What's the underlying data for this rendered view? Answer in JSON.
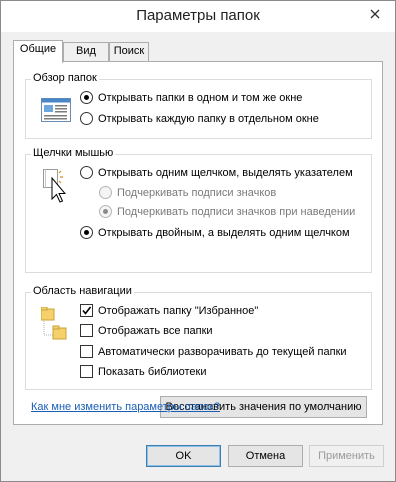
{
  "window": {
    "title": "Параметры папок",
    "close_label": "✕"
  },
  "tabs": [
    {
      "label": "Общие",
      "active": true
    },
    {
      "label": "Вид",
      "active": false
    },
    {
      "label": "Поиск",
      "active": false
    }
  ],
  "browse_folders": {
    "label": "Обзор папок",
    "options": [
      {
        "label": "Открывать папки в одном и том же окне",
        "checked": true
      },
      {
        "label": "Открывать каждую папку в отдельном окне",
        "checked": false
      }
    ]
  },
  "mouse_clicks": {
    "label": "Щелчки мышью",
    "options": [
      {
        "label": "Открывать одним щелчком, выделять указателем",
        "checked": false
      },
      {
        "label": "Подчеркивать подписи значков",
        "checked": false,
        "disabled": true
      },
      {
        "label": "Подчеркивать подписи значков при наведении",
        "checked": true,
        "disabled": true
      },
      {
        "label": "Открывать двойным, а выделять одним щелчком",
        "checked": true
      }
    ]
  },
  "navigation": {
    "label": "Область навигации",
    "options": [
      {
        "label": "Отображать папку \"Избранное\"",
        "checked": true
      },
      {
        "label": "Отображать все папки",
        "checked": false
      },
      {
        "label": "Автоматически разворачивать до текущей папки",
        "checked": false
      },
      {
        "label": "Показать библиотеки",
        "checked": false
      }
    ]
  },
  "restore_button": "Восстановить значения по умолчанию",
  "help_link": "Как мне изменить параметры папок?",
  "footer": {
    "ok": "OK",
    "cancel": "Отмена",
    "apply": "Применить"
  }
}
